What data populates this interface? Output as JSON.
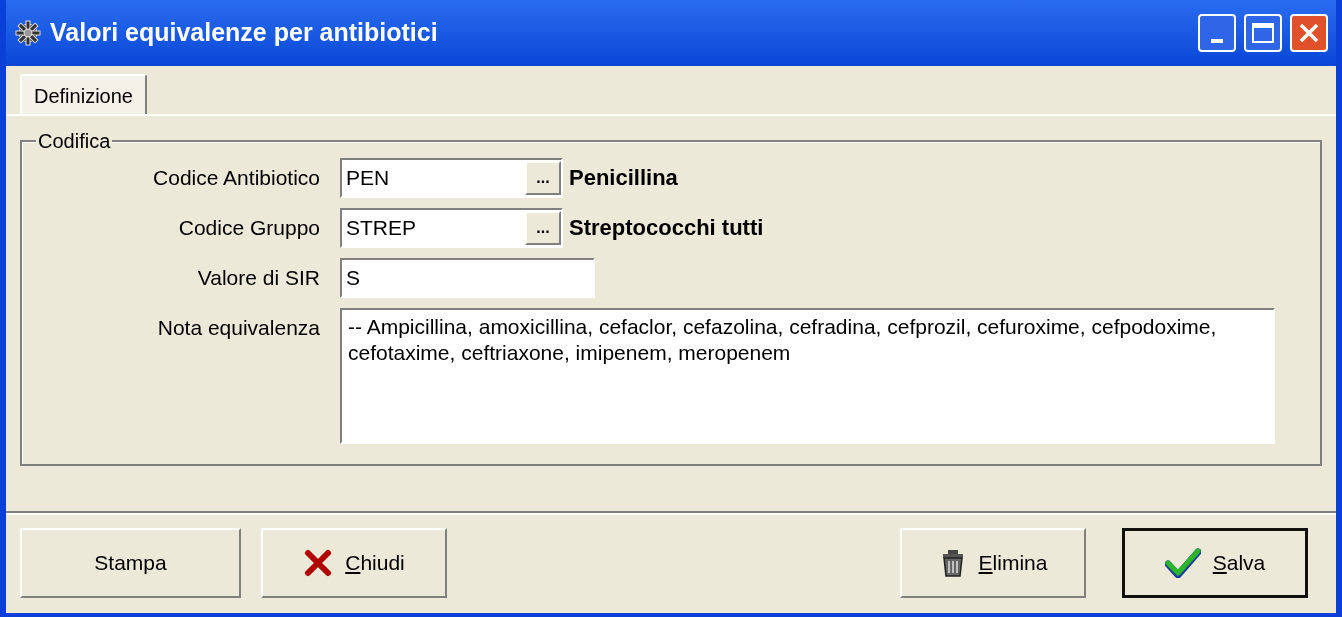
{
  "window": {
    "title": "Valori equivalenze per antibiotici"
  },
  "tabs": [
    {
      "label": "Definizione",
      "selected": true
    }
  ],
  "group": {
    "title": "Codifica",
    "fields": [
      {
        "kind": "lookup",
        "label": "Codice Antibiotico",
        "value": "PEN",
        "button": "...",
        "description": "Penicillina"
      },
      {
        "kind": "lookup",
        "label": "Codice Gruppo",
        "value": "STREP",
        "button": "...",
        "description": "Streptococchi tutti"
      },
      {
        "kind": "text",
        "label": "Valore di SIR",
        "value": "S"
      },
      {
        "kind": "memo",
        "label": "Nota equivalenza",
        "value": "-- Ampicillina, amoxicillina, cefaclor, cefazolina, cefradina, cefprozil, cefuroxime, cefpodoxime, cefotaxime, ceftriaxone, imipenem, meropenem"
      }
    ]
  },
  "buttons": [
    {
      "label": "Stampa",
      "kind": "plain",
      "mnemonic": false,
      "default": false
    },
    {
      "label": "Chiudi",
      "kind": "close",
      "mnemonic": true,
      "default": false
    },
    {
      "label": "Elimina",
      "kind": "delete",
      "mnemonic": true,
      "default": false
    },
    {
      "label": "Salva",
      "kind": "save",
      "mnemonic": true,
      "default": true
    }
  ]
}
